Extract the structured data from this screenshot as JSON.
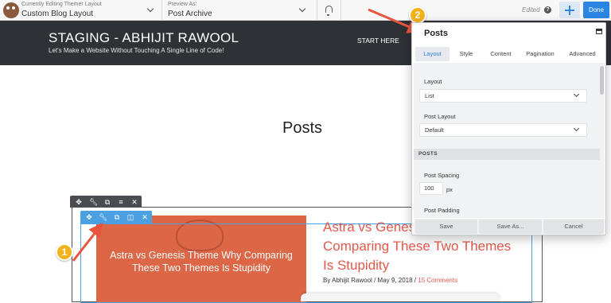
{
  "topbar": {
    "editing_caption": "Currently Editing Themer Layout",
    "layout_name": "Custom Blog Layout",
    "preview_caption": "Preview As:",
    "preview_value": "Post Archive",
    "status": "Edited",
    "done_label": "Done",
    "icons": [
      "builder-logo-icon",
      "chevron-down-icon",
      "bell-icon",
      "help-icon",
      "plus-icon"
    ]
  },
  "site": {
    "title": "STAGING - ABHIJIT RAWOOL",
    "tagline": "Let's Make a Website Without Touching A Single Line of Code!",
    "nav_start": "START HERE"
  },
  "page": {
    "heading": "Posts",
    "post": {
      "image_text": "Astra vs Genesis Theme Why Comparing These Two Themes Is Stupidity",
      "title_line1": "Astra vs Genes",
      "title_line2": "Comparing These Two Themes",
      "title_line3": "Is Stupidity",
      "meta_by": "By",
      "author": "Abhijit Rawool",
      "date": "May 9, 2018",
      "comments": "15 Comments",
      "separator": "/"
    }
  },
  "annotations": {
    "badge1": "1",
    "badge2": "2",
    "color": "#f2b21e",
    "arrow_color": "#e8553f"
  },
  "panel": {
    "title": "Posts",
    "tabs": [
      "Layout",
      "Style",
      "Content",
      "Pagination",
      "Advanced"
    ],
    "active_tab": "Layout",
    "layout_label": "Layout",
    "layout_value": "List",
    "post_layout_label": "Post Layout",
    "post_layout_value": "Default",
    "section_posts": "POSTS",
    "post_spacing_label": "Post Spacing",
    "post_spacing_value": "100",
    "post_spacing_unit": "px",
    "post_padding_label": "Post Padding",
    "save_label": "Save",
    "save_as_label": "Save As...",
    "cancel_label": "Cancel"
  },
  "colors": {
    "accent": "#2b86e3",
    "header_bg": "#2e3136",
    "featured_bg": "#dd6646",
    "link": "#e4584a"
  }
}
